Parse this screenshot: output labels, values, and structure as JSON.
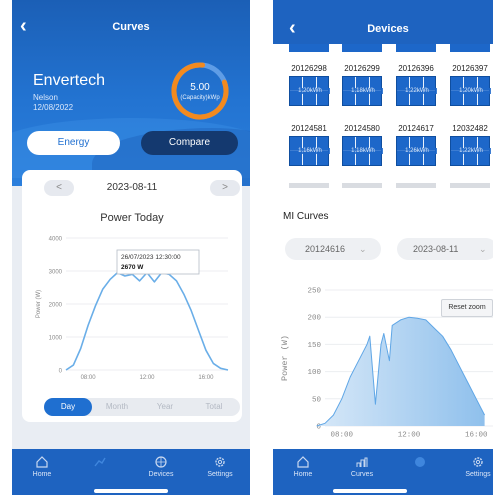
{
  "left": {
    "title": "Curves",
    "site": {
      "name": "Envertech",
      "location": "Nelson",
      "date": "12/08/2022"
    },
    "gauge": {
      "value": "5.00",
      "label": "(Capacity)kWp",
      "fill_fraction": 0.82
    },
    "tabs": [
      "Energy",
      "Compare"
    ],
    "date": "2023-08-11",
    "prev": "<",
    "next": ">",
    "chart_title": "Power Today",
    "tooltip": {
      "time": "26/07/2023 12:30:00",
      "value": "2670 W"
    },
    "period_tabs": [
      "Day",
      "Month",
      "Year",
      "Total"
    ],
    "nav": [
      "Home",
      "",
      "Devices",
      "Settings"
    ]
  },
  "right": {
    "title": "Devices",
    "device_rows": [
      [
        {
          "sn": "20126298",
          "kwh": "1.20kWh"
        },
        {
          "sn": "20126299",
          "kwh": "1.18kWh"
        },
        {
          "sn": "20126396",
          "kwh": "1.22kWh"
        },
        {
          "sn": "20126397",
          "kwh": "1.20kWh"
        }
      ],
      [
        {
          "sn": "20124581",
          "kwh": "1.16kWh"
        },
        {
          "sn": "20124580",
          "kwh": "1.18kWh"
        },
        {
          "sn": "20124617",
          "kwh": "1.26kWh"
        },
        {
          "sn": "12032482",
          "kwh": "1.22kWh"
        }
      ]
    ],
    "mi_title": "MI Curves",
    "device_select": "20124616",
    "date_select": "2023-08-11",
    "reset_zoom": "Reset zoom",
    "nav": [
      "Home",
      "Curves",
      "",
      "Settings"
    ]
  },
  "chart_data": [
    {
      "type": "area",
      "title": "Power Today",
      "xlabel": "",
      "ylabel": "Power (W)",
      "ylim": [
        0,
        4000
      ],
      "yticks": [
        "0",
        "1000",
        "2000",
        "3000",
        "4000"
      ],
      "xticks": [
        "08:00",
        "12:00",
        "16:00"
      ],
      "x": [
        "06:30",
        "07:00",
        "07:30",
        "08:00",
        "08:30",
        "09:00",
        "09:30",
        "10:00",
        "10:30",
        "11:00",
        "11:30",
        "12:00",
        "12:30",
        "13:00",
        "13:30",
        "14:00",
        "14:30",
        "15:00",
        "15:30",
        "16:00",
        "16:30",
        "17:00",
        "17:30"
      ],
      "series": [
        {
          "name": "",
          "values": [
            0,
            150,
            650,
            1350,
            1950,
            2450,
            2750,
            2950,
            2850,
            2900,
            2700,
            2950,
            2670,
            2950,
            2900,
            2700,
            2300,
            1800,
            1200,
            600,
            200,
            50,
            0
          ]
        }
      ],
      "grid": true
    },
    {
      "type": "area",
      "title": "",
      "xlabel": "",
      "ylabel": "Power (W)",
      "ylim": [
        0,
        250
      ],
      "yticks": [
        "0",
        "50",
        "100",
        "150",
        "200",
        "250"
      ],
      "xticks": [
        "08:00",
        "12:00",
        "16:00"
      ],
      "x": [
        "06:30",
        "07:00",
        "07:30",
        "08:00",
        "08:30",
        "09:00",
        "09:20",
        "09:30",
        "09:40",
        "10:00",
        "10:20",
        "10:30",
        "10:50",
        "11:00",
        "11:30",
        "12:00",
        "12:30",
        "13:00",
        "13:30",
        "14:00",
        "14:30",
        "15:00",
        "15:30",
        "16:00",
        "16:30"
      ],
      "series": [
        {
          "name": "",
          "values": [
            0,
            5,
            20,
            50,
            90,
            120,
            140,
            150,
            165,
            40,
            150,
            170,
            120,
            185,
            195,
            200,
            198,
            195,
            180,
            165,
            140,
            110,
            80,
            50,
            20
          ]
        }
      ],
      "grid": true
    }
  ]
}
